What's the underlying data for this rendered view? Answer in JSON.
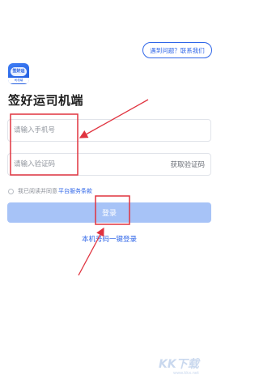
{
  "header": {
    "help_label": "遇到问题？联系我们"
  },
  "logo": {
    "text": "签好运",
    "sub": "司机端"
  },
  "title": "签好运司机端",
  "form": {
    "phone_placeholder": "请输入手机号",
    "code_placeholder": "请输入验证码",
    "get_code_label": "获取验证码"
  },
  "agreement": {
    "prefix": "我已阅读并同意",
    "link": "平台服务条款"
  },
  "login_label": "登录",
  "one_key_login_label": "本机号码一键登录",
  "annotation_color": "#e0333f",
  "watermark": {
    "text": "KK下载",
    "url": "www.kkx.net"
  }
}
